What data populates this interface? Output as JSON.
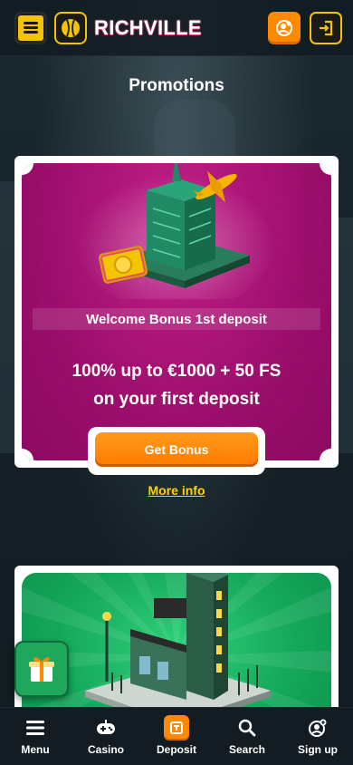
{
  "header": {
    "brand": "RICHVILLE",
    "icons": [
      "menu-icon",
      "logo-ball-icon",
      "profile-icon",
      "login-icon"
    ]
  },
  "page": {
    "title": "Promotions"
  },
  "promos": [
    {
      "subtitle": "Welcome Bonus 1st deposit",
      "offer_line1": "100% up to €1000 + 50 FS",
      "offer_line2": "on your first deposit",
      "button_label": "Get Bonus",
      "more_info_label": "More info"
    }
  ],
  "nav": {
    "items": [
      {
        "label": "Menu",
        "icon": "hamburger-icon"
      },
      {
        "label": "Casino",
        "icon": "gamepad-icon"
      },
      {
        "label": "Deposit",
        "icon": "wallet-icon"
      },
      {
        "label": "Search",
        "icon": "search-icon"
      },
      {
        "label": "Sign up",
        "icon": "user-plus-icon"
      }
    ]
  },
  "colors": {
    "accent_orange": "#ff8a00",
    "accent_yellow": "#f5c400",
    "promo_magenta": "#9c0e6c",
    "promo_green": "#14a85a",
    "background": "#152027"
  }
}
